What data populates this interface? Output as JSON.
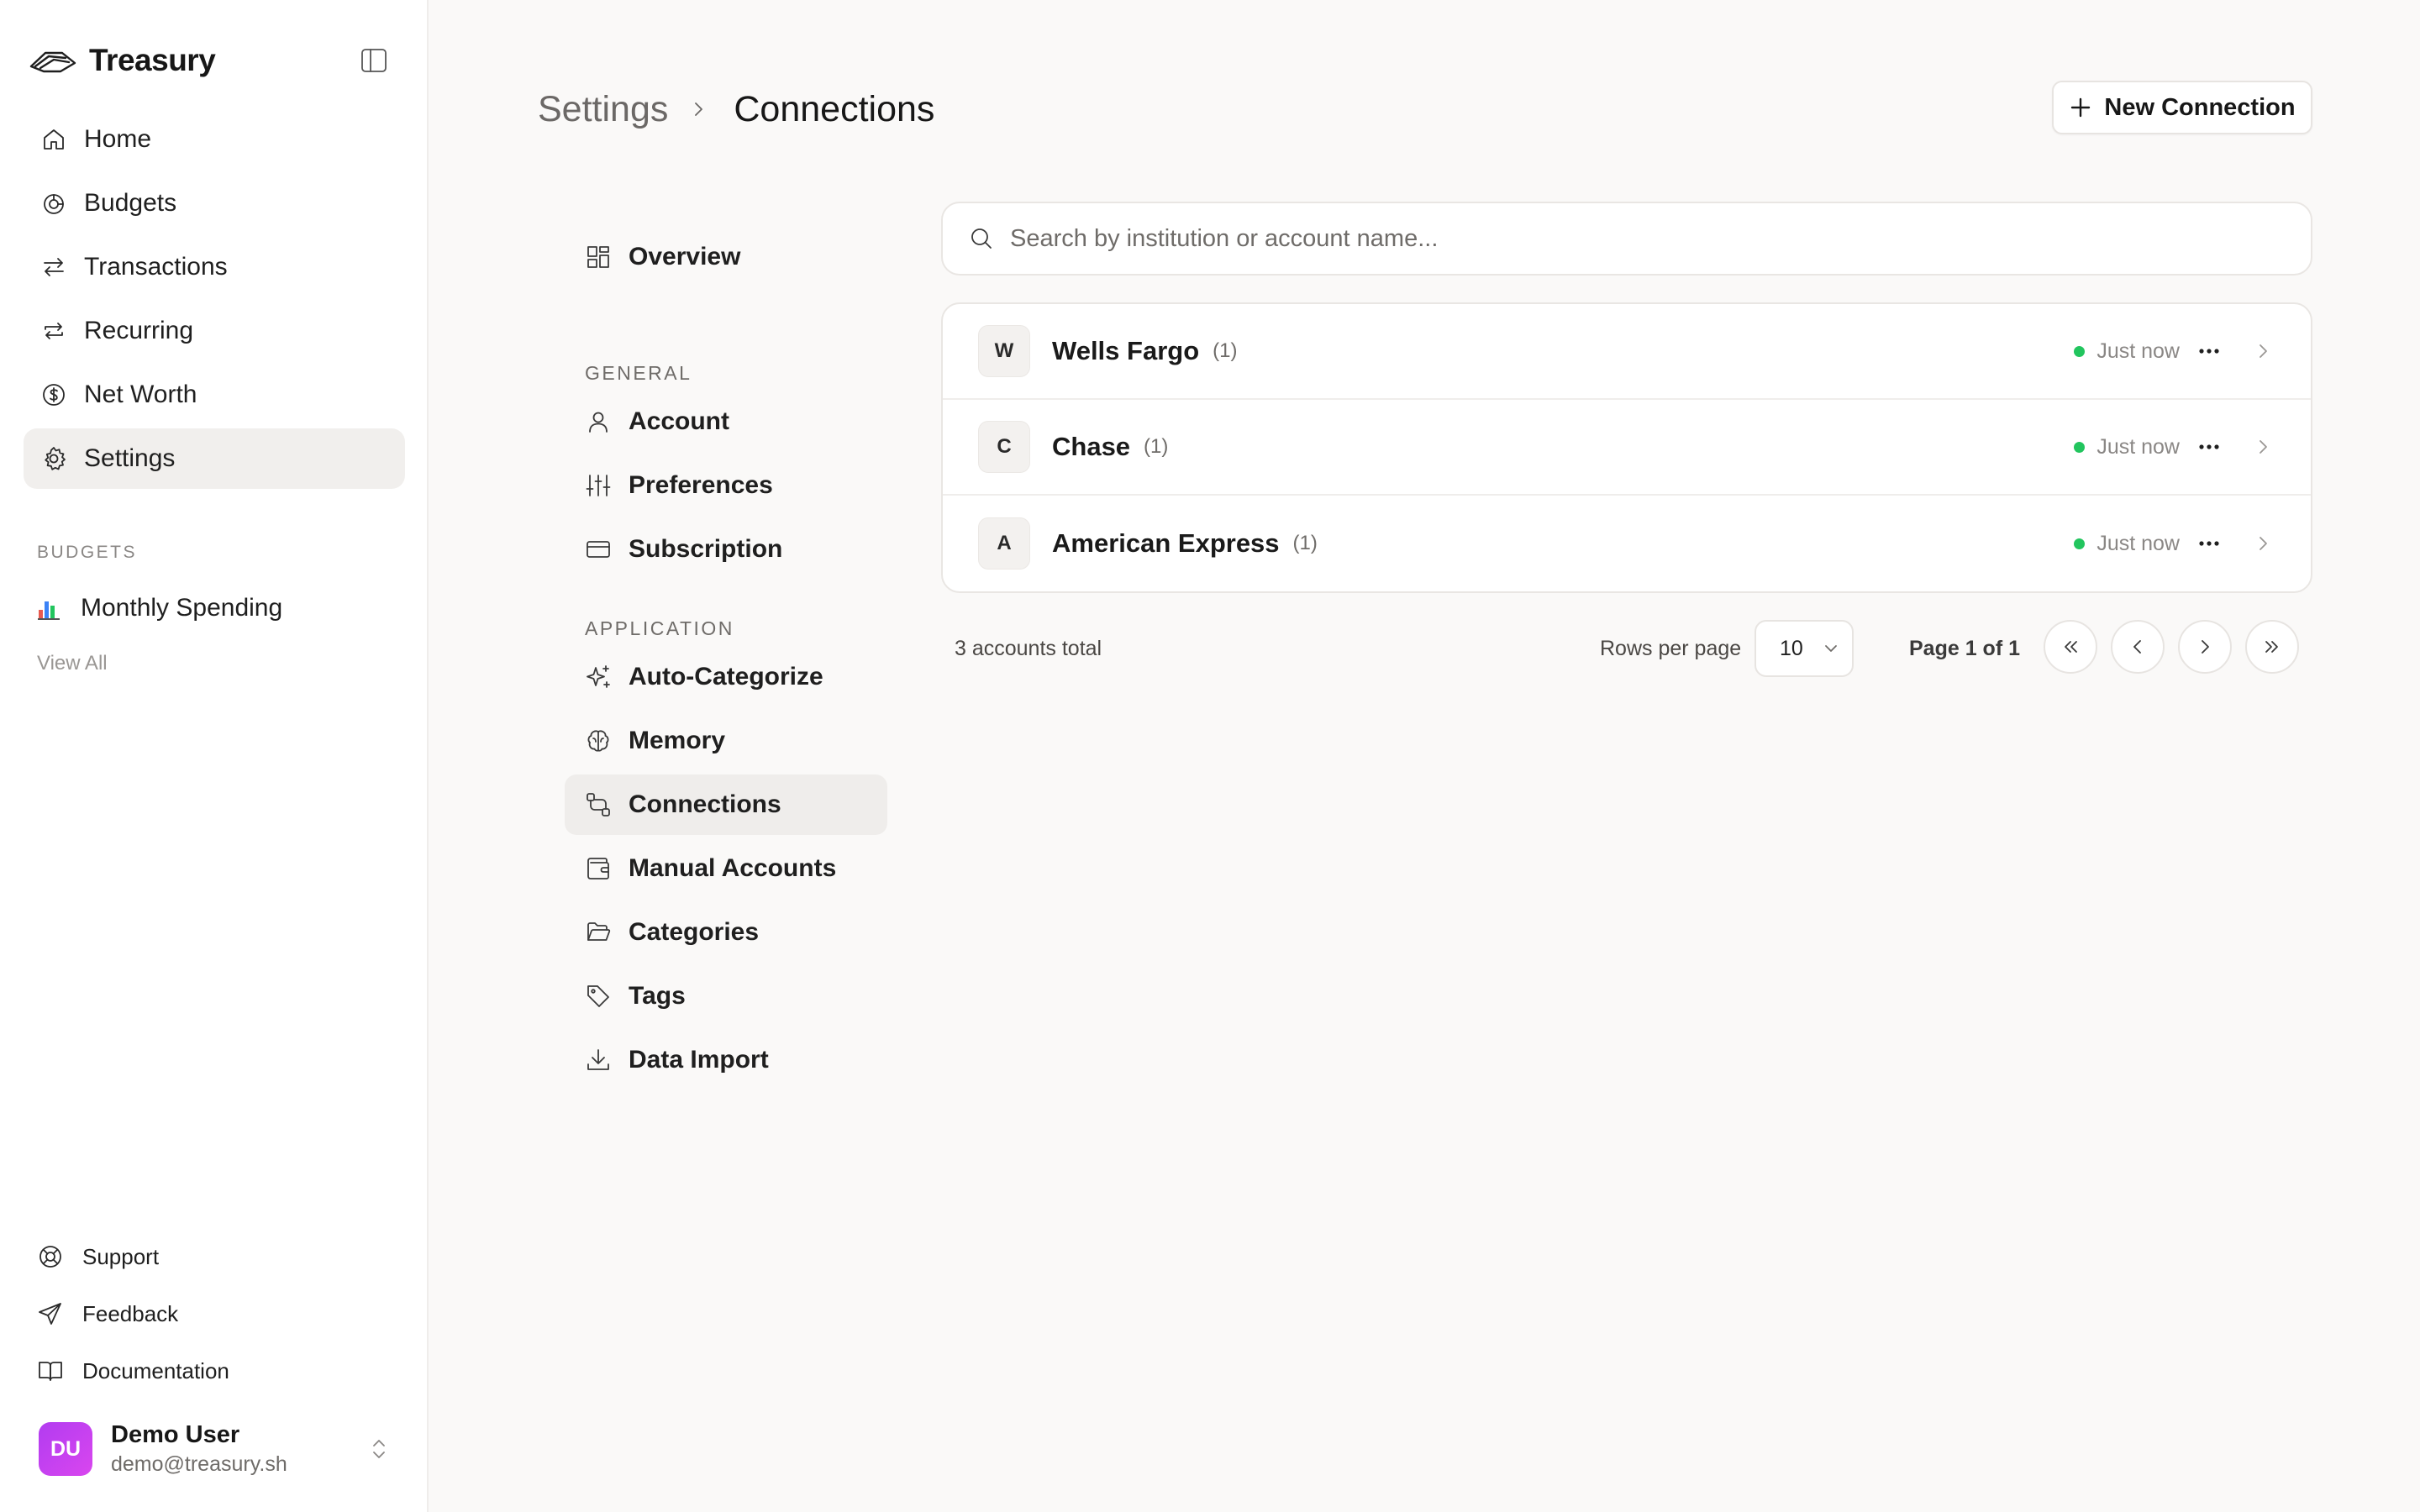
{
  "app": {
    "name": "Treasury"
  },
  "sidebar": {
    "nav": [
      {
        "label": "Home",
        "icon": "home-icon"
      },
      {
        "label": "Budgets",
        "icon": "budgets-icon"
      },
      {
        "label": "Transactions",
        "icon": "transactions-icon"
      },
      {
        "label": "Recurring",
        "icon": "recurring-icon"
      },
      {
        "label": "Net Worth",
        "icon": "net-worth-icon"
      },
      {
        "label": "Settings",
        "icon": "gear-icon",
        "active": true
      }
    ],
    "budgets_title": "BUDGETS",
    "budget_items": [
      {
        "label": "Monthly Spending",
        "icon": "bar-chart-icon"
      }
    ],
    "view_all": "View All",
    "bottom_links": [
      {
        "label": "Support",
        "icon": "lifebuoy-icon"
      },
      {
        "label": "Feedback",
        "icon": "send-icon"
      },
      {
        "label": "Documentation",
        "icon": "book-icon"
      }
    ],
    "user": {
      "initials": "DU",
      "name": "Demo User",
      "email": "demo@treasury.sh"
    }
  },
  "header": {
    "breadcrumb_parent": "Settings",
    "breadcrumb_current": "Connections",
    "new_connection_label": "New Connection"
  },
  "settings_nav": {
    "overview": "Overview",
    "general_title": "GENERAL",
    "general": [
      "Account",
      "Preferences",
      "Subscription"
    ],
    "application_title": "APPLICATION",
    "application": [
      "Auto-Categorize",
      "Memory",
      "Connections",
      "Manual Accounts",
      "Categories",
      "Tags",
      "Data Import"
    ],
    "active": "Connections"
  },
  "search": {
    "placeholder": "Search by institution or account name...",
    "value": ""
  },
  "connections": [
    {
      "initial": "W",
      "name": "Wells Fargo",
      "count": "(1)",
      "status": "Just now"
    },
    {
      "initial": "C",
      "name": "Chase",
      "count": "(1)",
      "status": "Just now"
    },
    {
      "initial": "A",
      "name": "American Express",
      "count": "(1)",
      "status": "Just now"
    }
  ],
  "pagination": {
    "total_text": "3 accounts total",
    "rows_per_page_label": "Rows per page",
    "rows_per_page_value": "10",
    "page_text": "Page 1 of 1"
  },
  "colors": {
    "status_ok": "#22c55e",
    "avatar_gradient": [
      "#b23cf0",
      "#d946ef"
    ],
    "active_bg": "#f1efed"
  }
}
